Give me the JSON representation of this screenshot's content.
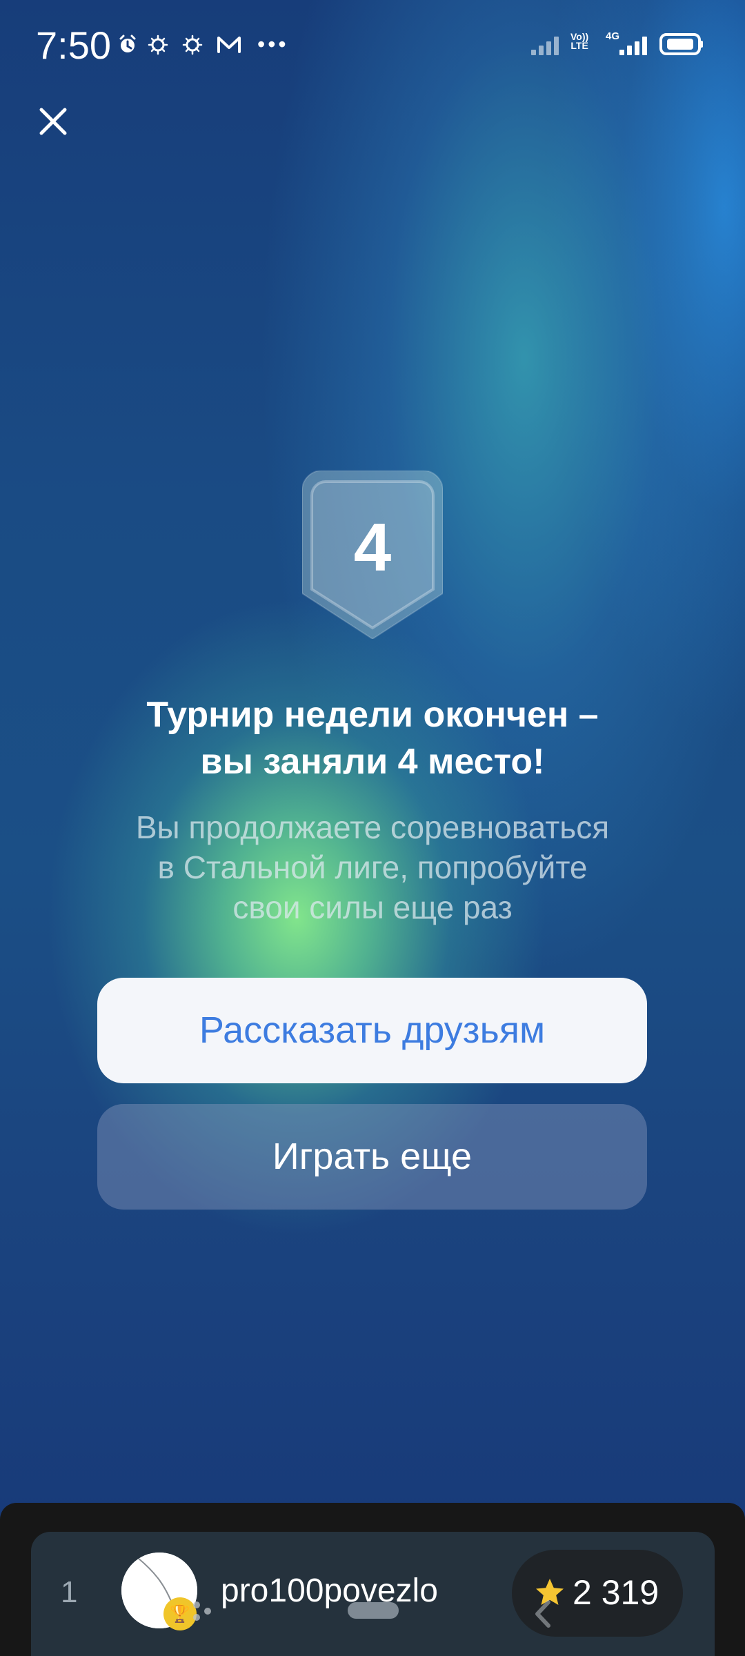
{
  "status_bar": {
    "time": "7:50",
    "volte": "Vo))\nLTE",
    "network": "4G"
  },
  "icons": {
    "close": "close-icon",
    "alarm": "alarm-icon",
    "notifications": "notification-icon",
    "mail": "mail-icon",
    "more": "more-icon",
    "signal": "signal-icon",
    "battery": "battery-icon",
    "star": "star-icon",
    "trophy": "trophy-icon",
    "back": "chevron-left-icon"
  },
  "result": {
    "place": "4",
    "title": "Турнир недели окончен –\nвы заняли 4 место!",
    "description": "Вы продолжаете соревноваться\nв Стальной лиге, попробуйте\nсвои силы еще раз"
  },
  "actions": {
    "share": "Рассказать друзьям",
    "play_again": "Играть еще"
  },
  "leaderboard": {
    "rank": "1",
    "username": "pro100povezlo",
    "score": "2 319"
  },
  "colors": {
    "primary_button_text": "#3d7ce0",
    "primary_button_bg": "#f4f6fa",
    "secondary_button_bg": "#8c9abe",
    "background_deep_blue": "#173a79",
    "background_green_glow": "#84e88c",
    "bottom_panel": "#25323d",
    "score_pill": "#1f2327",
    "trophy": "#f0c52a"
  }
}
